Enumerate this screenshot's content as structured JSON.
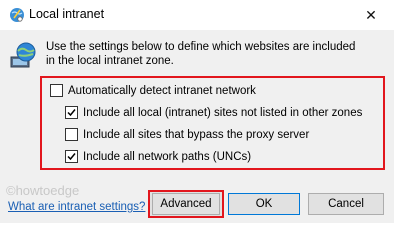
{
  "window": {
    "title": "Local intranet",
    "close_glyph": "✕"
  },
  "description": "Use the settings below to define which websites are included in the local intranet zone.",
  "options": [
    {
      "label": "Automatically detect intranet network",
      "checked": false
    },
    {
      "label": "Include all local (intranet) sites not listed in other zones",
      "checked": true
    },
    {
      "label": "Include all sites that bypass the proxy server",
      "checked": false
    },
    {
      "label": "Include all network paths (UNCs)",
      "checked": true
    }
  ],
  "watermark": "©howtoedge",
  "help_link": "What are intranet settings?",
  "buttons": {
    "advanced": "Advanced",
    "ok": "OK",
    "cancel": "Cancel"
  },
  "colors": {
    "highlight": "#e2161d",
    "link": "#1a5fb4",
    "focus_border": "#0078d7"
  }
}
